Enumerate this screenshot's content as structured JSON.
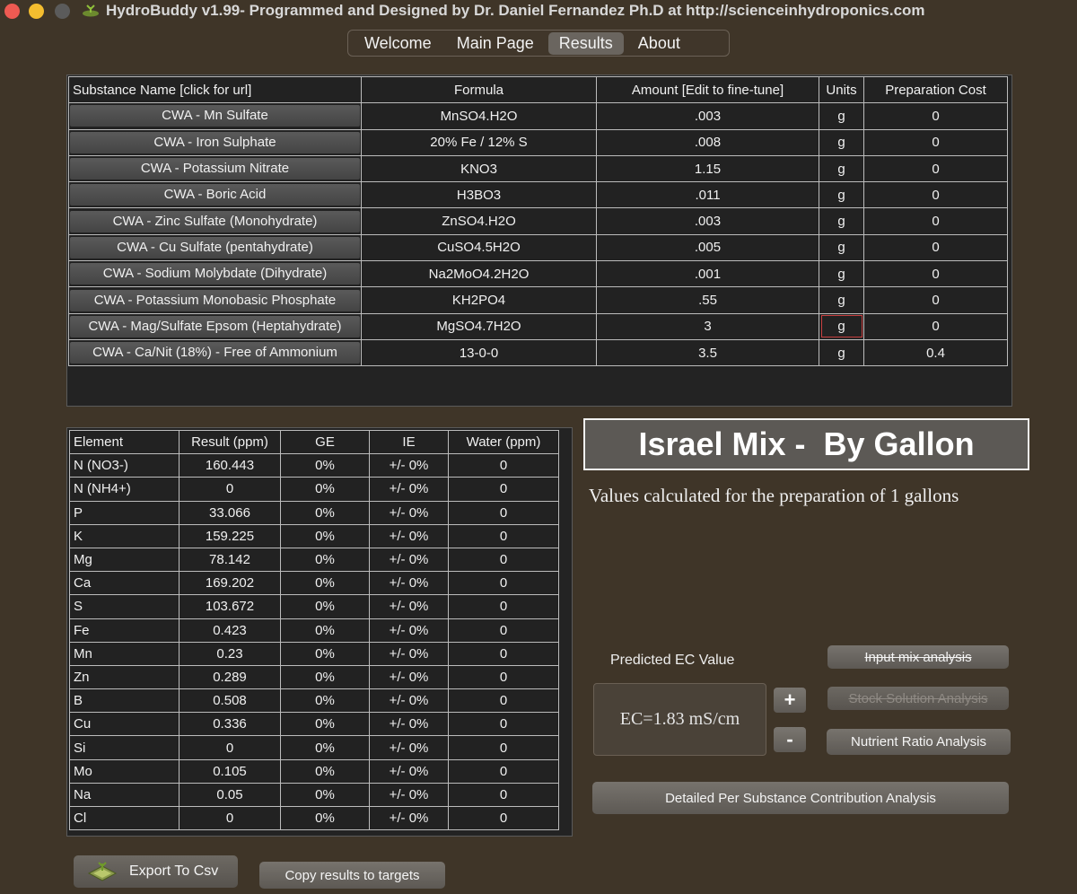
{
  "window": {
    "title": "HydroBuddy v1.99- Programmed and Designed by Dr. Daniel Fernandez Ph.D at http://scienceinhydroponics.com"
  },
  "tabs": [
    {
      "label": "Welcome",
      "active": false
    },
    {
      "label": "Main Page",
      "active": false
    },
    {
      "label": "Results",
      "active": true
    },
    {
      "label": "About",
      "active": false
    }
  ],
  "substances": {
    "headers": [
      "Substance Name [click for url]",
      "Formula",
      "Amount [Edit to fine-tune]",
      "Units",
      "Preparation Cost"
    ],
    "rows": [
      {
        "name": "CWA - Mn Sulfate",
        "formula": "MnSO4.H2O",
        "amount": ".003",
        "units": "g",
        "cost": "0"
      },
      {
        "name": "CWA - Iron Sulphate",
        "formula": "20% Fe / 12% S",
        "amount": ".008",
        "units": "g",
        "cost": "0"
      },
      {
        "name": "CWA - Potassium Nitrate",
        "formula": "KNO3",
        "amount": "1.15",
        "units": "g",
        "cost": "0"
      },
      {
        "name": "CWA - Boric Acid",
        "formula": "H3BO3",
        "amount": ".011",
        "units": "g",
        "cost": "0"
      },
      {
        "name": "CWA - Zinc Sulfate (Monohydrate)",
        "formula": "ZnSO4.H2O",
        "amount": ".003",
        "units": "g",
        "cost": "0"
      },
      {
        "name": "CWA - Cu Sulfate (pentahydrate)",
        "formula": "CuSO4.5H2O",
        "amount": ".005",
        "units": "g",
        "cost": "0"
      },
      {
        "name": "CWA - Sodium Molybdate (Dihydrate)",
        "formula": "Na2MoO4.2H2O",
        "amount": ".001",
        "units": "g",
        "cost": "0"
      },
      {
        "name": "CWA - Potassium Monobasic Phosphate",
        "formula": "KH2PO4",
        "amount": ".55",
        "units": "g",
        "cost": "0"
      },
      {
        "name": "CWA - Mag/Sulfate Epsom (Heptahydrate)",
        "formula": "MgSO4.7H2O",
        "amount": "3",
        "units": "g",
        "cost": "0"
      },
      {
        "name": "CWA - Ca/Nit (18%) - Free of Ammonium",
        "formula": "13-0-0",
        "amount": "3.5",
        "units": "g",
        "cost": "0.4"
      }
    ]
  },
  "elements": {
    "headers": [
      "Element",
      "Result (ppm)",
      "GE",
      "IE",
      "Water (ppm)"
    ],
    "rows": [
      {
        "element": "N (NO3-)",
        "result": "160.443",
        "ge": "0%",
        "ie": "+/- 0%",
        "water": "0"
      },
      {
        "element": "N (NH4+)",
        "result": "0",
        "ge": "0%",
        "ie": "+/- 0%",
        "water": "0"
      },
      {
        "element": "P",
        "result": "33.066",
        "ge": "0%",
        "ie": "+/- 0%",
        "water": "0"
      },
      {
        "element": "K",
        "result": "159.225",
        "ge": "0%",
        "ie": "+/- 0%",
        "water": "0"
      },
      {
        "element": "Mg",
        "result": "78.142",
        "ge": "0%",
        "ie": "+/- 0%",
        "water": "0"
      },
      {
        "element": "Ca",
        "result": "169.202",
        "ge": "0%",
        "ie": "+/- 0%",
        "water": "0"
      },
      {
        "element": "S",
        "result": "103.672",
        "ge": "0%",
        "ie": "+/- 0%",
        "water": "0"
      },
      {
        "element": "Fe",
        "result": "0.423",
        "ge": "0%",
        "ie": "+/- 0%",
        "water": "0"
      },
      {
        "element": "Mn",
        "result": "0.23",
        "ge": "0%",
        "ie": "+/- 0%",
        "water": "0"
      },
      {
        "element": "Zn",
        "result": "0.289",
        "ge": "0%",
        "ie": "+/- 0%",
        "water": "0"
      },
      {
        "element": "B",
        "result": "0.508",
        "ge": "0%",
        "ie": "+/- 0%",
        "water": "0"
      },
      {
        "element": "Cu",
        "result": "0.336",
        "ge": "0%",
        "ie": "+/- 0%",
        "water": "0"
      },
      {
        "element": "Si",
        "result": "0",
        "ge": "0%",
        "ie": "+/- 0%",
        "water": "0"
      },
      {
        "element": "Mo",
        "result": "0.105",
        "ge": "0%",
        "ie": "+/- 0%",
        "water": "0"
      },
      {
        "element": "Na",
        "result": "0.05",
        "ge": "0%",
        "ie": "+/- 0%",
        "water": "0"
      },
      {
        "element": "Cl",
        "result": "0",
        "ge": "0%",
        "ie": "+/- 0%",
        "water": "0"
      }
    ]
  },
  "mix": {
    "title": "Israel Mix -  By Gallon",
    "values_text": "Values calculated for the preparation of 1 gallons"
  },
  "ec": {
    "label": "Predicted EC Value",
    "value": "EC=1.83 mS/cm",
    "plus": "+",
    "minus": "-"
  },
  "buttons": {
    "input_mix": "Input mix analysis",
    "stock_solution": "Stock Solution Analysis",
    "nutrient_ratio": "Nutrient Ratio Analysis",
    "detailed": "Detailed Per Substance Contribution Analysis",
    "export_csv": "Export To Csv",
    "copy_results": "Copy results to targets"
  },
  "icons": {
    "app": "hydroponics-plant-icon",
    "export": "spreadsheet-icon"
  }
}
